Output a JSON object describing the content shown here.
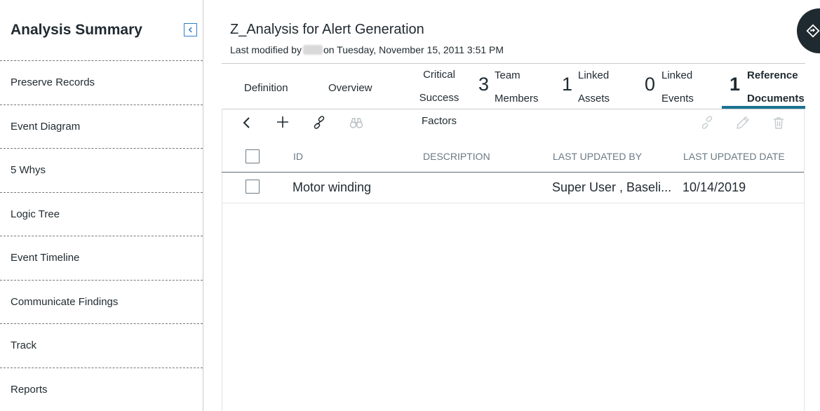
{
  "sidebar": {
    "title": "Analysis Summary",
    "items": [
      {
        "label": "Preserve Records"
      },
      {
        "label": "Event Diagram"
      },
      {
        "label": "5 Whys"
      },
      {
        "label": "Logic Tree"
      },
      {
        "label": "Event Timeline"
      },
      {
        "label": "Communicate Findings"
      },
      {
        "label": "Track"
      },
      {
        "label": "Reports"
      }
    ]
  },
  "header": {
    "title": "Z_Analysis for Alert Generation",
    "modified_prefix": "Last modified by",
    "modified_suffix": "on Tuesday, November 15, 2011 3:51 PM"
  },
  "tabs": {
    "definition": {
      "label": "Definition"
    },
    "overview": {
      "label": "Overview"
    },
    "critical": {
      "line1": "Critical",
      "line2": "Success",
      "line3": "Factors"
    },
    "team": {
      "count": "3",
      "line1": "Team",
      "line2": "Members"
    },
    "assets": {
      "count": "1",
      "line1": "Linked",
      "line2": "Assets"
    },
    "events": {
      "count": "0",
      "line1": "Linked",
      "line2": "Events"
    },
    "documents": {
      "count": "1",
      "line1": "Reference",
      "line2": "Documents"
    }
  },
  "toolbar": {
    "back_icon": "chevron-left-icon",
    "add_icon": "plus-icon",
    "link_icon": "link-icon",
    "search_icon": "binoculars-icon",
    "unlink_icon": "unlink-icon",
    "edit_icon": "pencil-icon",
    "delete_icon": "trash-icon"
  },
  "table": {
    "columns": [
      "ID",
      "DESCRIPTION",
      "LAST UPDATED BY",
      "LAST UPDATED DATE"
    ],
    "rows": [
      {
        "id": "Motor winding",
        "description": "",
        "updated_by": "Super User , Baseli...",
        "updated_date": "10/14/2019"
      }
    ]
  },
  "colors": {
    "accent": "#1a7491",
    "collapse_button": "#2f7fc1",
    "nav_button": "#1f2a30"
  }
}
